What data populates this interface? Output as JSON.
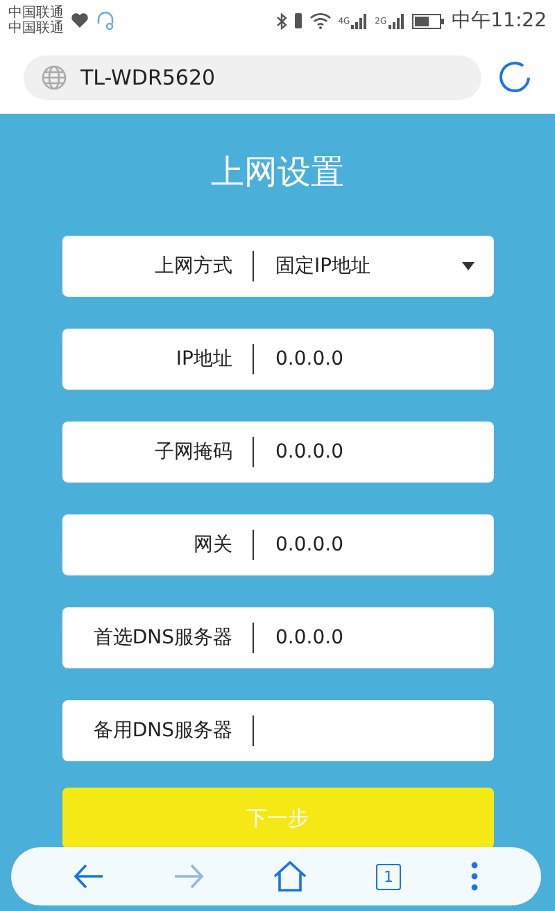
{
  "status_bar": {
    "carriers": [
      "中国联通",
      "中国联通"
    ],
    "network_labels": [
      "4G",
      "2G"
    ],
    "time": "中午11:22"
  },
  "address_bar": {
    "url": "TL-WDR5620"
  },
  "page": {
    "title": "上网设置",
    "fields": [
      {
        "kind": "select",
        "label": "上网方式",
        "value": "固定IP地址"
      },
      {
        "kind": "input",
        "label": "IP地址",
        "value": "0.0.0.0"
      },
      {
        "kind": "input",
        "label": "子网掩码",
        "value": "0.0.0.0"
      },
      {
        "kind": "input",
        "label": "网关",
        "value": "0.0.0.0"
      },
      {
        "kind": "input",
        "label": "首选DNS服务器",
        "value": "0.0.0.0"
      },
      {
        "kind": "input",
        "label": "备用DNS服务器"
      }
    ],
    "next_button": "下一步"
  },
  "nav": {
    "tab_count": "1"
  }
}
